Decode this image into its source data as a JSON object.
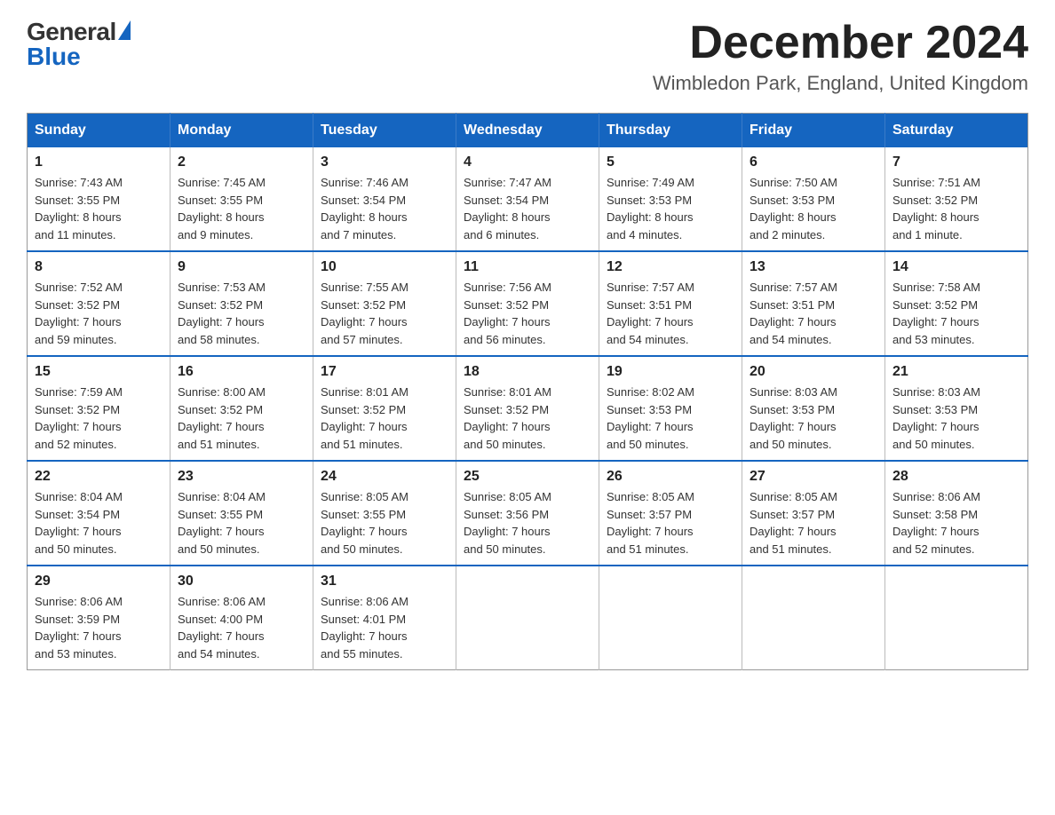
{
  "logo": {
    "general": "General",
    "blue": "Blue"
  },
  "title": {
    "month": "December 2024",
    "location": "Wimbledon Park, England, United Kingdom"
  },
  "days_of_week": [
    "Sunday",
    "Monday",
    "Tuesday",
    "Wednesday",
    "Thursday",
    "Friday",
    "Saturday"
  ],
  "weeks": [
    [
      {
        "day": "1",
        "sunrise": "7:43 AM",
        "sunset": "3:55 PM",
        "daylight": "8 hours and 11 minutes."
      },
      {
        "day": "2",
        "sunrise": "7:45 AM",
        "sunset": "3:55 PM",
        "daylight": "8 hours and 9 minutes."
      },
      {
        "day": "3",
        "sunrise": "7:46 AM",
        "sunset": "3:54 PM",
        "daylight": "8 hours and 7 minutes."
      },
      {
        "day": "4",
        "sunrise": "7:47 AM",
        "sunset": "3:54 PM",
        "daylight": "8 hours and 6 minutes."
      },
      {
        "day": "5",
        "sunrise": "7:49 AM",
        "sunset": "3:53 PM",
        "daylight": "8 hours and 4 minutes."
      },
      {
        "day": "6",
        "sunrise": "7:50 AM",
        "sunset": "3:53 PM",
        "daylight": "8 hours and 2 minutes."
      },
      {
        "day": "7",
        "sunrise": "7:51 AM",
        "sunset": "3:52 PM",
        "daylight": "8 hours and 1 minute."
      }
    ],
    [
      {
        "day": "8",
        "sunrise": "7:52 AM",
        "sunset": "3:52 PM",
        "daylight": "7 hours and 59 minutes."
      },
      {
        "day": "9",
        "sunrise": "7:53 AM",
        "sunset": "3:52 PM",
        "daylight": "7 hours and 58 minutes."
      },
      {
        "day": "10",
        "sunrise": "7:55 AM",
        "sunset": "3:52 PM",
        "daylight": "7 hours and 57 minutes."
      },
      {
        "day": "11",
        "sunrise": "7:56 AM",
        "sunset": "3:52 PM",
        "daylight": "7 hours and 56 minutes."
      },
      {
        "day": "12",
        "sunrise": "7:57 AM",
        "sunset": "3:51 PM",
        "daylight": "7 hours and 54 minutes."
      },
      {
        "day": "13",
        "sunrise": "7:57 AM",
        "sunset": "3:51 PM",
        "daylight": "7 hours and 54 minutes."
      },
      {
        "day": "14",
        "sunrise": "7:58 AM",
        "sunset": "3:52 PM",
        "daylight": "7 hours and 53 minutes."
      }
    ],
    [
      {
        "day": "15",
        "sunrise": "7:59 AM",
        "sunset": "3:52 PM",
        "daylight": "7 hours and 52 minutes."
      },
      {
        "day": "16",
        "sunrise": "8:00 AM",
        "sunset": "3:52 PM",
        "daylight": "7 hours and 51 minutes."
      },
      {
        "day": "17",
        "sunrise": "8:01 AM",
        "sunset": "3:52 PM",
        "daylight": "7 hours and 51 minutes."
      },
      {
        "day": "18",
        "sunrise": "8:01 AM",
        "sunset": "3:52 PM",
        "daylight": "7 hours and 50 minutes."
      },
      {
        "day": "19",
        "sunrise": "8:02 AM",
        "sunset": "3:53 PM",
        "daylight": "7 hours and 50 minutes."
      },
      {
        "day": "20",
        "sunrise": "8:03 AM",
        "sunset": "3:53 PM",
        "daylight": "7 hours and 50 minutes."
      },
      {
        "day": "21",
        "sunrise": "8:03 AM",
        "sunset": "3:53 PM",
        "daylight": "7 hours and 50 minutes."
      }
    ],
    [
      {
        "day": "22",
        "sunrise": "8:04 AM",
        "sunset": "3:54 PM",
        "daylight": "7 hours and 50 minutes."
      },
      {
        "day": "23",
        "sunrise": "8:04 AM",
        "sunset": "3:55 PM",
        "daylight": "7 hours and 50 minutes."
      },
      {
        "day": "24",
        "sunrise": "8:05 AM",
        "sunset": "3:55 PM",
        "daylight": "7 hours and 50 minutes."
      },
      {
        "day": "25",
        "sunrise": "8:05 AM",
        "sunset": "3:56 PM",
        "daylight": "7 hours and 50 minutes."
      },
      {
        "day": "26",
        "sunrise": "8:05 AM",
        "sunset": "3:57 PM",
        "daylight": "7 hours and 51 minutes."
      },
      {
        "day": "27",
        "sunrise": "8:05 AM",
        "sunset": "3:57 PM",
        "daylight": "7 hours and 51 minutes."
      },
      {
        "day": "28",
        "sunrise": "8:06 AM",
        "sunset": "3:58 PM",
        "daylight": "7 hours and 52 minutes."
      }
    ],
    [
      {
        "day": "29",
        "sunrise": "8:06 AM",
        "sunset": "3:59 PM",
        "daylight": "7 hours and 53 minutes."
      },
      {
        "day": "30",
        "sunrise": "8:06 AM",
        "sunset": "4:00 PM",
        "daylight": "7 hours and 54 minutes."
      },
      {
        "day": "31",
        "sunrise": "8:06 AM",
        "sunset": "4:01 PM",
        "daylight": "7 hours and 55 minutes."
      },
      null,
      null,
      null,
      null
    ]
  ],
  "labels": {
    "sunrise": "Sunrise:",
    "sunset": "Sunset:",
    "daylight": "Daylight:"
  }
}
